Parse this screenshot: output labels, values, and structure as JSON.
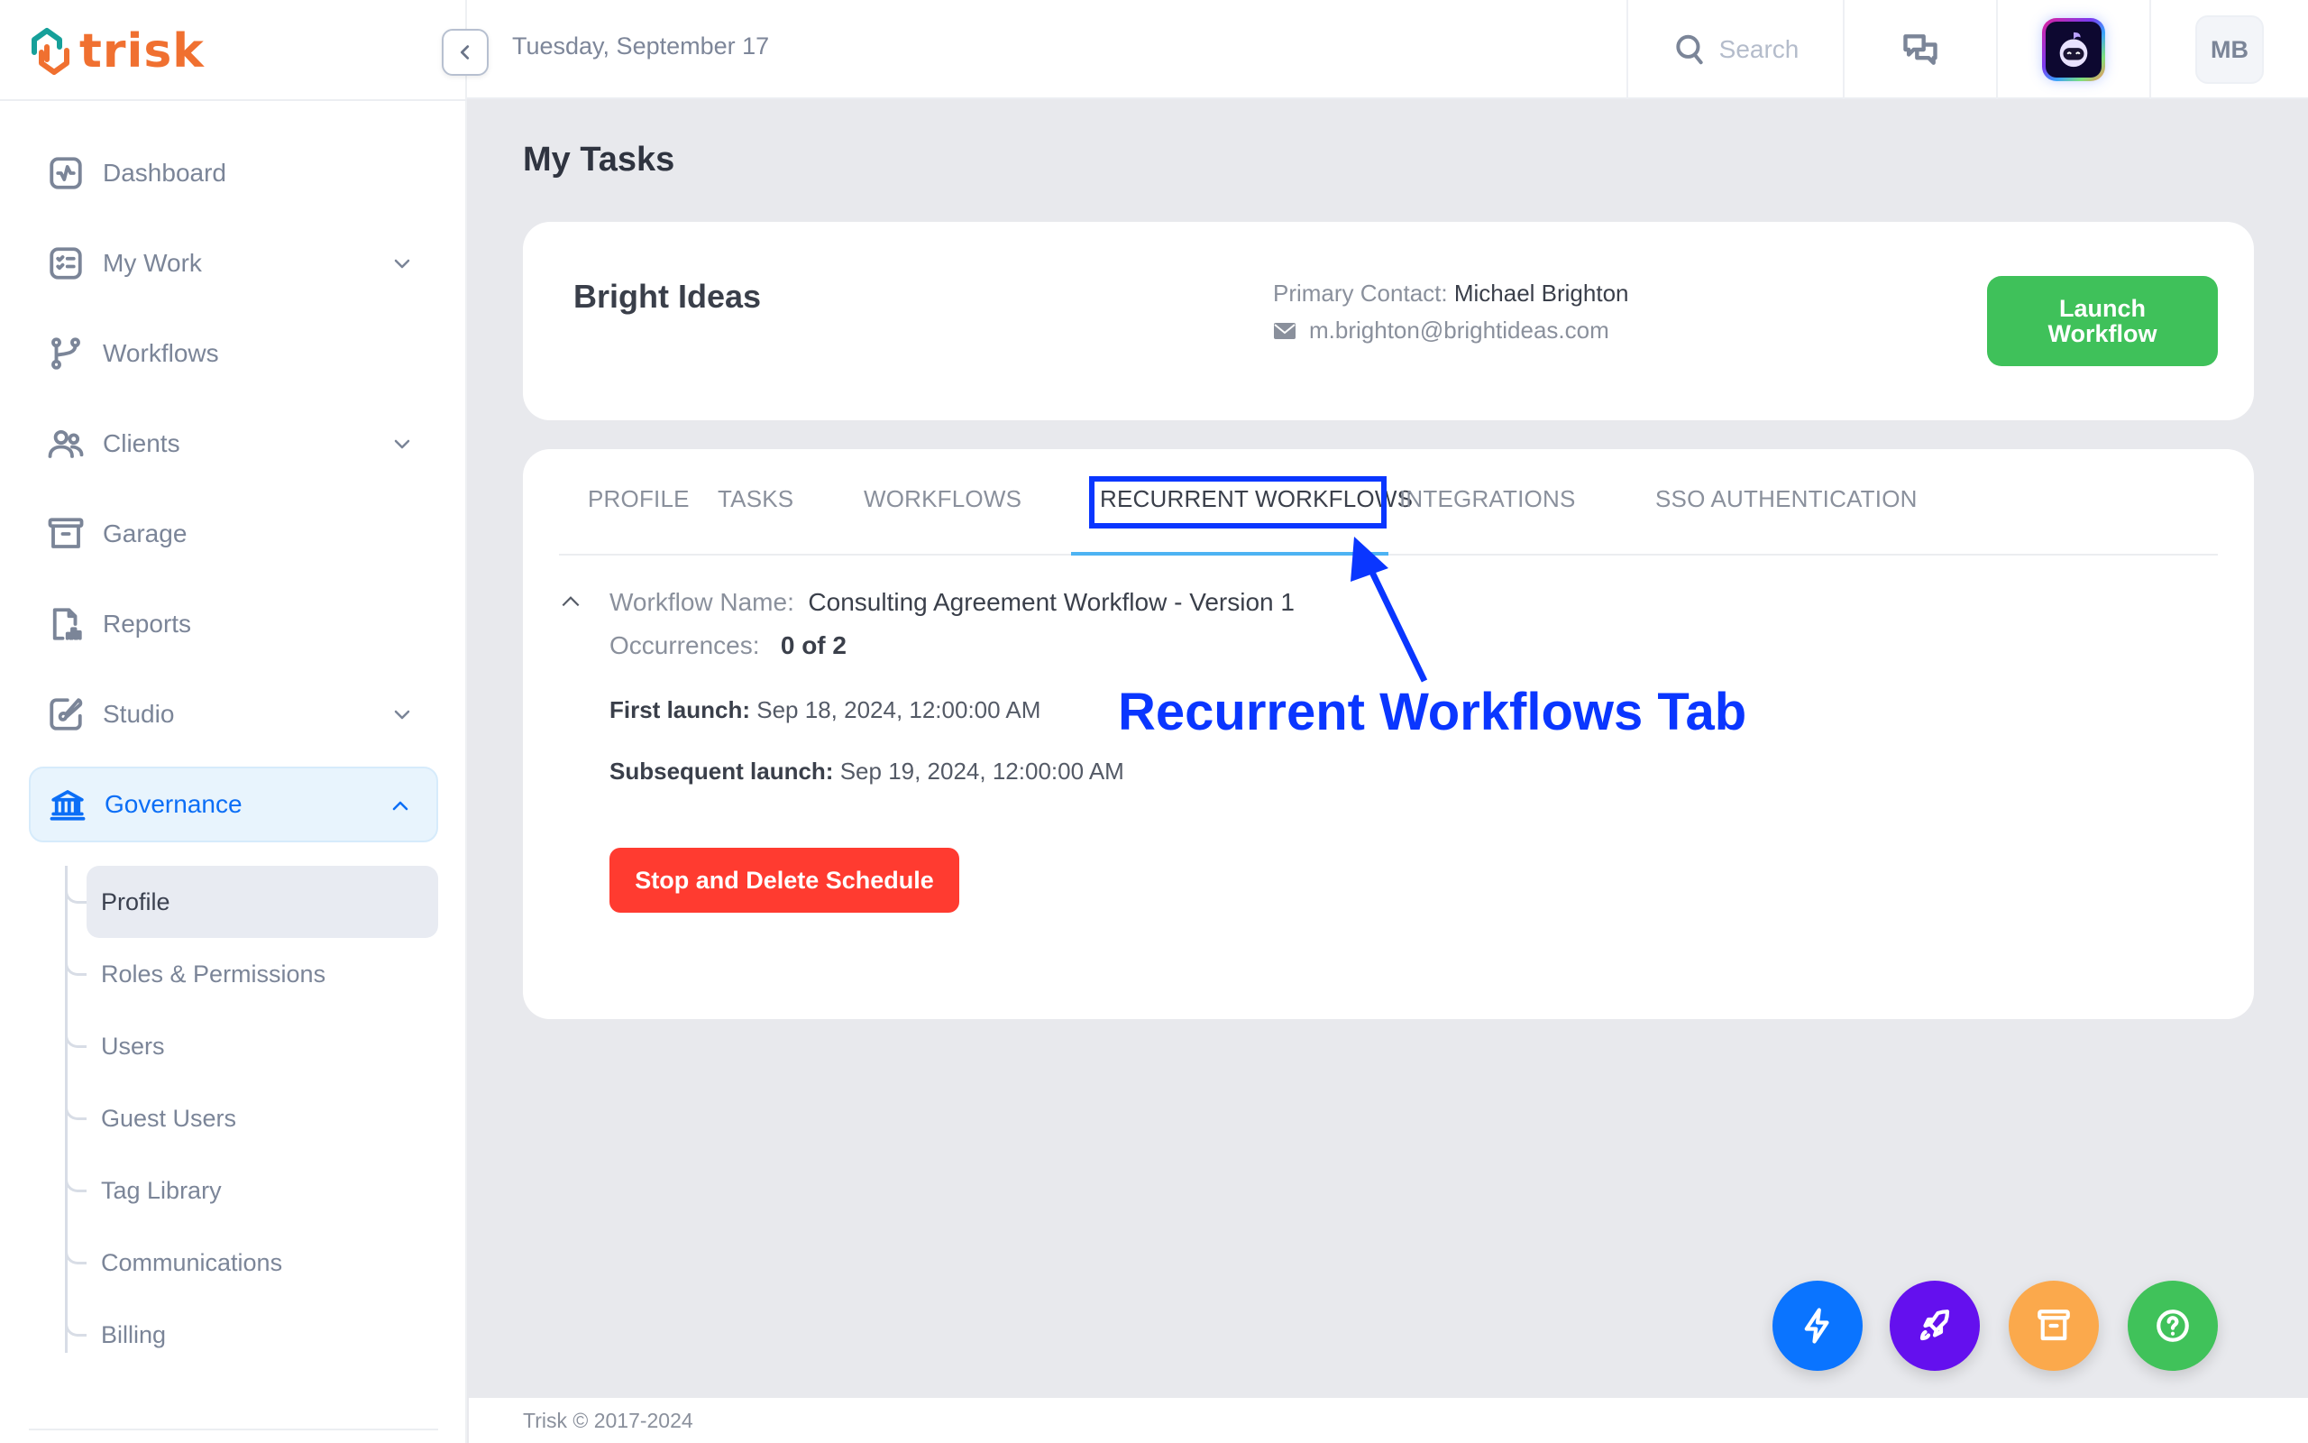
{
  "app": {
    "name": "trisk"
  },
  "header": {
    "date": "Tuesday, September 17",
    "search_placeholder": "Search",
    "avatar_initials": "MB"
  },
  "sidebar": {
    "items": [
      {
        "label": "Dashboard",
        "icon": "pulse-icon",
        "expandable": false
      },
      {
        "label": "My Work",
        "icon": "checklist-icon",
        "expandable": true
      },
      {
        "label": "Workflows",
        "icon": "git-branch-icon",
        "expandable": false
      },
      {
        "label": "Clients",
        "icon": "users-icon",
        "expandable": true
      },
      {
        "label": "Garage",
        "icon": "archive-icon",
        "expandable": false
      },
      {
        "label": "Reports",
        "icon": "report-icon",
        "expandable": false
      },
      {
        "label": "Studio",
        "icon": "brush-icon",
        "expandable": true
      },
      {
        "label": "Governance",
        "icon": "bank-icon",
        "expandable": true,
        "active": true
      }
    ],
    "governance_subitems": [
      {
        "label": "Profile",
        "active": true
      },
      {
        "label": "Roles & Permissions"
      },
      {
        "label": "Users"
      },
      {
        "label": "Guest Users"
      },
      {
        "label": "Tag Library"
      },
      {
        "label": "Communications"
      },
      {
        "label": "Billing"
      }
    ]
  },
  "main": {
    "page_title": "My Tasks",
    "client": {
      "name": "Bright Ideas",
      "primary_contact_label": "Primary Contact:",
      "primary_contact_name": "Michael Brighton",
      "email": "m.brighton@brightideas.com",
      "launch_button": "Launch Workflow"
    },
    "tabs": [
      {
        "label": "PROFILE"
      },
      {
        "label": "TASKS"
      },
      {
        "label": "WORKFLOWS"
      },
      {
        "label": "RECURRENT WORKFLOWS",
        "active": true
      },
      {
        "label": "INTEGRATIONS"
      },
      {
        "label": "SSO AUTHENTICATION"
      }
    ],
    "recurrent_workflow": {
      "name_label": "Workflow Name:",
      "name_value": "Consulting Agreement Workflow - Version 1",
      "occurrences_label": "Occurrences:",
      "occurrences_value": "0 of 2",
      "first_launch_label": "First launch:",
      "first_launch_value": "Sep 18, 2024, 12:00:00 AM",
      "subsequent_launch_label": "Subsequent launch:",
      "subsequent_launch_value": "Sep 19, 2024, 12:00:00 AM",
      "stop_button": "Stop and Delete Schedule"
    }
  },
  "annotation": {
    "text": "Recurrent Workflows Tab",
    "color": "#0a36ff"
  },
  "footer": {
    "copyright": "Trisk © 2017-2024"
  },
  "fabs": [
    {
      "name": "quick-action",
      "icon": "lightning-icon",
      "color": "#0a74ff"
    },
    {
      "name": "launch",
      "icon": "rocket-icon",
      "color": "#6410ee"
    },
    {
      "name": "archive",
      "icon": "archive-icon",
      "color": "#fba94c"
    },
    {
      "name": "help",
      "icon": "help-icon",
      "color": "#40c25a"
    }
  ],
  "colors": {
    "brand_orange": "#f07030",
    "brand_teal": "#16a09a",
    "accent_blue": "#0b6ef6",
    "launch_green": "#3fc15a",
    "danger_red": "#ff3b30",
    "tab_underline": "#4db3f3"
  }
}
